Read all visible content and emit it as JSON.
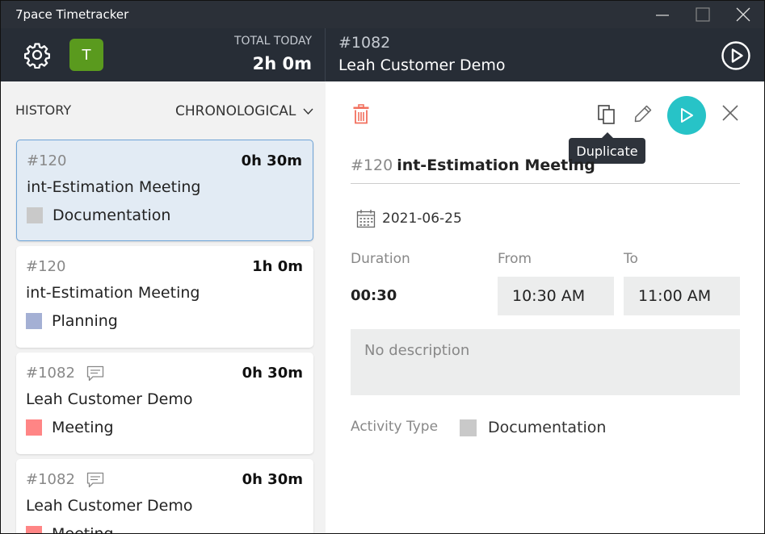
{
  "app": {
    "title": "7pace Timetracker"
  },
  "header": {
    "avatar_initial": "T",
    "total_label": "TOTAL TODAY",
    "total_value": "2h 0m",
    "current_id": "#1082",
    "current_title": "Leah Customer Demo"
  },
  "history": {
    "label": "HISTORY",
    "sort_label": "CHRONOLOGICAL",
    "items": [
      {
        "id": "#120",
        "time": "0h 30m",
        "name": "int-Estimation Meeting",
        "activity": "Documentation",
        "color": "#c9c9c9",
        "comment": false,
        "selected": true
      },
      {
        "id": "#120",
        "time": "1h 0m",
        "name": "int-Estimation Meeting",
        "activity": "Planning",
        "color": "#a4b0d4",
        "comment": false,
        "selected": false
      },
      {
        "id": "#1082",
        "time": "0h 30m",
        "name": "Leah Customer Demo",
        "activity": "Meeting",
        "color": "#ff8585",
        "comment": true,
        "selected": false
      },
      {
        "id": "#1082",
        "time": "0h 30m",
        "name": "Leah Customer Demo",
        "activity": "Meeting",
        "color": "#ff8585",
        "comment": true,
        "selected": false
      }
    ]
  },
  "detail": {
    "tooltip": "Duplicate",
    "task_id": "#120",
    "task_name": "int-Estimation Meeting",
    "date": "2021-06-25",
    "duration_label": "Duration",
    "duration_value": "00:30",
    "from_label": "From",
    "from_value": "10:30 AM",
    "to_label": "To",
    "to_value": "11:00 AM",
    "description_placeholder": "No description",
    "activity_label": "Activity Type",
    "activity_value": "Documentation"
  },
  "colors": {
    "accent": "#27c3c7",
    "delete": "#f2705e",
    "selected_border": "#6fa4d7",
    "avatar": "#5a9a1e"
  }
}
